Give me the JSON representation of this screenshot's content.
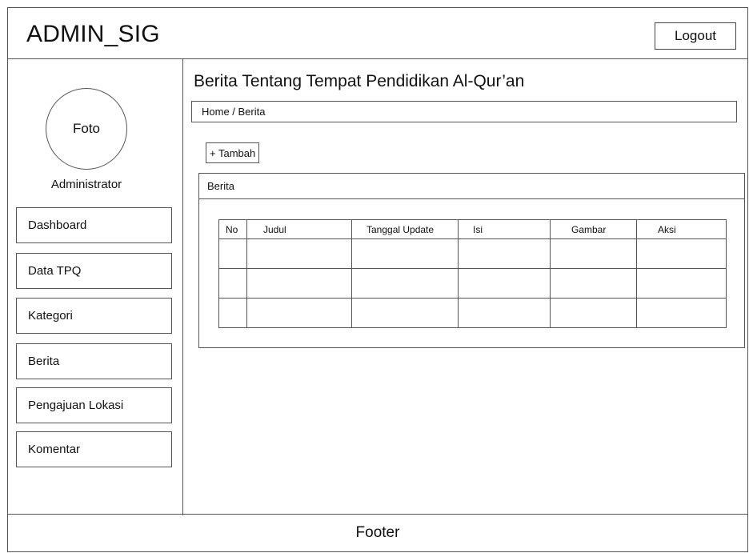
{
  "header": {
    "app_title": "ADMIN_SIG",
    "logout_label": "Logout"
  },
  "sidebar": {
    "avatar_label": "Foto",
    "role": "Administrator",
    "items": [
      {
        "label": "Dashboard"
      },
      {
        "label": "Data TPQ"
      },
      {
        "label": "Kategori"
      },
      {
        "label": "Berita"
      },
      {
        "label": "Pengajuan Lokasi"
      },
      {
        "label": "Komentar"
      }
    ]
  },
  "main": {
    "page_title": "Berita Tentang Tempat Pendidikan Al-Qur’an",
    "breadcrumb": "Home / Berita",
    "add_button": "+ Tambah",
    "panel_title": "Berita",
    "table": {
      "columns": [
        "No",
        "Judul",
        "Tanggal Update",
        "Isi",
        "Gambar",
        "Aksi"
      ],
      "rows": [
        [
          "",
          "",
          "",
          "",
          "",
          ""
        ],
        [
          "",
          "",
          "",
          "",
          "",
          ""
        ],
        [
          "",
          "",
          "",
          "",
          "",
          ""
        ]
      ]
    }
  },
  "footer": {
    "label": "Footer"
  }
}
